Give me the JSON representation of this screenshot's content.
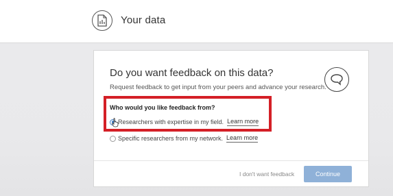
{
  "header": {
    "title": "Your data",
    "icon": "document-chart-icon"
  },
  "card": {
    "title": "Do you want feedback on this data?",
    "subtitle": "Request feedback to get input from your peers and advance your research.",
    "icon": "comment-icon",
    "question": "Who would you like feedback from?",
    "options": [
      {
        "label": "Researchers with expertise in my field.",
        "link": "Learn more",
        "selected": true
      },
      {
        "label": "Specific researchers from my network.",
        "link": "Learn more",
        "selected": false
      }
    ],
    "decline_label": "I don't want feedback",
    "continue_label": "Continue"
  },
  "colors": {
    "highlight": "#d41f26",
    "continue_button": "#8fb1d8",
    "radio_selected": "#3a7bc8"
  }
}
